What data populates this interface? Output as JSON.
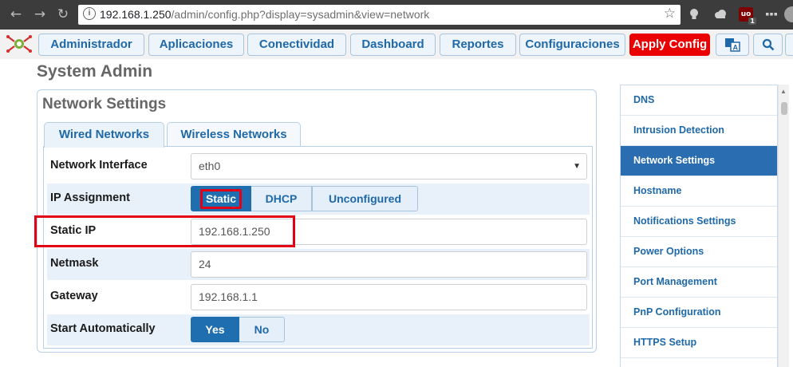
{
  "browser": {
    "url_host": "192.168.1.250",
    "url_path": "/admin/config.php?display=sysadmin&view=network",
    "back_glyph": "←",
    "forward_glyph": "→",
    "reload_glyph": "↻",
    "star_glyph": "☆",
    "info_glyph": "i",
    "ext_ublock_label": "uo",
    "ext_ublock_badge": "1",
    "menu_glyph": "⋮"
  },
  "nav": {
    "items": [
      "Administrador",
      "Aplicaciones",
      "Conectividad",
      "Dashboard",
      "Reportes",
      "Configuraciones"
    ],
    "apply_label": "Apply Config",
    "apply_color": "#ea0000",
    "search_glyph": "⚲"
  },
  "page": {
    "title": "System Admin"
  },
  "panel": {
    "title": "Network Settings",
    "tabs": [
      "Wired Networks",
      "Wireless Networks"
    ],
    "fields": {
      "interface_label": "Network Interface",
      "interface_value": "eth0",
      "select_arrow": "▼",
      "ip_assignment_label": "IP Assignment",
      "ip_assignment_options": [
        "Static",
        "DHCP",
        "Unconfigured"
      ],
      "ip_assignment_selected": "Static",
      "static_ip_label": "Static IP",
      "static_ip_value": "192.168.1.250",
      "netmask_label": "Netmask",
      "netmask_value": "24",
      "gateway_label": "Gateway",
      "gateway_value": "192.168.1.1",
      "start_auto_label": "Start Automatically",
      "start_auto_options": [
        "Yes",
        "No"
      ],
      "start_auto_selected": "Yes"
    }
  },
  "sidebar": {
    "items": [
      "DNS",
      "Intrusion Detection",
      "Network Settings",
      "Hostname",
      "Notifications Settings",
      "Power Options",
      "Port Management",
      "PnP Configuration",
      "HTTPS Setup"
    ],
    "active": "Network Settings"
  },
  "colors": {
    "accent": "#2069a8",
    "active_bg": "#2a6db0",
    "highlight_red": "#e10015"
  }
}
